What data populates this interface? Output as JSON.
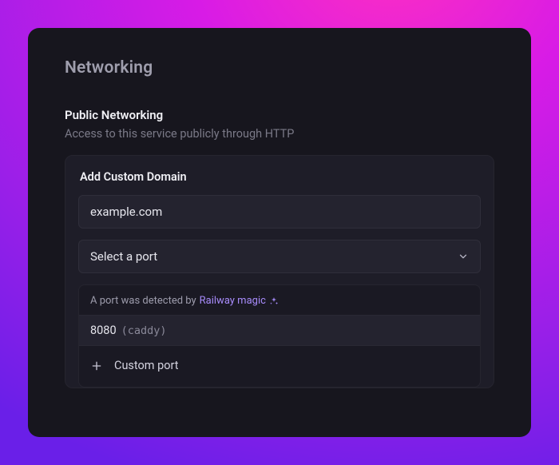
{
  "section": {
    "title": "Networking"
  },
  "public_networking": {
    "heading": "Public Networking",
    "description": "Access to this service publicly through HTTP"
  },
  "add_domain": {
    "title": "Add Custom Domain",
    "domain_value": "example.com",
    "port_select_label": "Select a port"
  },
  "port_dropdown": {
    "detected_prefix": "A port was detected by ",
    "detected_link": "Railway magic",
    "options": [
      {
        "port": "8080",
        "meta": "(caddy)"
      }
    ],
    "custom_label": "Custom port"
  }
}
